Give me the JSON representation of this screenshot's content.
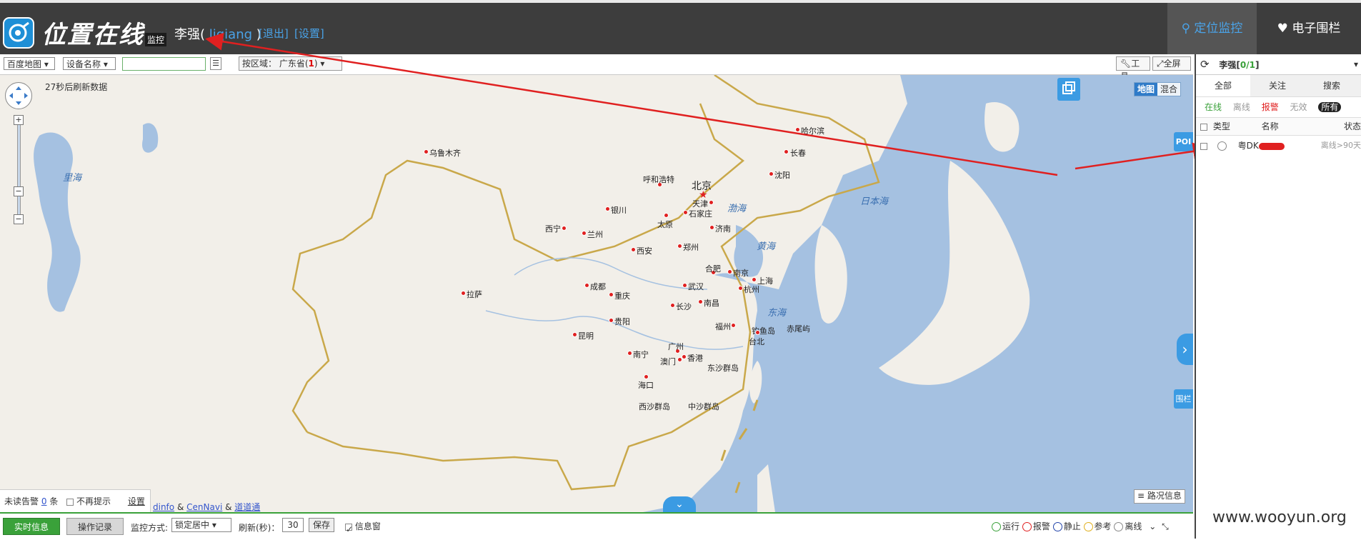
{
  "header": {
    "logo_text": "位置在线",
    "logo_badge": "监控",
    "user_name": "李强(",
    "user_account": " liqiang ",
    "user_close": ")",
    "logout": "[退出]",
    "settings": "[设置]",
    "nav_monitor": "定位监控",
    "nav_fence": "电子围栏"
  },
  "toolbar": {
    "map_select": "百度地图",
    "field_select": "设备名称",
    "search_value": "",
    "region_prefix": "按区域：",
    "region_name": "广东省(",
    "region_count": "1",
    "region_close": ")",
    "tools": "工具",
    "fullscreen": "全屏"
  },
  "map": {
    "refresh_text": "27秒后刷新数据",
    "maptype_map": "地图",
    "maptype_mixed": "混合",
    "poi": "POI",
    "fence": "围栏",
    "traffic": "路况信息",
    "attrib_a": "dinfo",
    "attrib_amp1": "&",
    "attrib_b": "CenNavi",
    "attrib_amp2": "&",
    "attrib_c": "道道通",
    "cities": {
      "urumqi": "乌鲁木齐",
      "harbin": "哈尔滨",
      "changchun": "长春",
      "shenyang": "沈阳",
      "hohhot": "呼和浩特",
      "beijing": "北京",
      "tianjin": "天津",
      "shijiazhuang": "石家庄",
      "taiyuan": "太原",
      "yinchuan": "银川",
      "jinan": "济南",
      "xining": "西宁",
      "lanzhou": "兰州",
      "xian": "西安",
      "zhengzhou": "郑州",
      "hefei": "合肥",
      "nanjing": "南京",
      "shanghai": "上海",
      "chengdu": "成都",
      "wuhan": "武汉",
      "hangzhou": "杭州",
      "lhasa": "拉萨",
      "chongqing": "重庆",
      "changsha": "长沙",
      "nanchang": "南昌",
      "guiyang": "贵阳",
      "fuzhou": "福州",
      "diaoyu": "钓鱼岛",
      "chiwei": "赤尾屿",
      "taibei": "台北",
      "kunming": "昆明",
      "guangzhou": "广州",
      "nanning": "南宁",
      "macau": "澳门",
      "hongkong": "香港",
      "dongsha": "东沙群岛",
      "haikou": "海口",
      "xisha": "西沙群岛",
      "zhongsha": "中沙群岛"
    },
    "seas": {
      "caspian": "里海",
      "bohai": "渤海",
      "yellow": "黄海",
      "east": "东海",
      "japan": "日本海"
    }
  },
  "alarm": {
    "unread_label": "未读告警",
    "unread_count": "0",
    "unread_unit": "条",
    "no_prompt": "不再提示",
    "settings": "设置"
  },
  "bottombar": {
    "realtime": "实时信息",
    "oplog": "操作记录",
    "monitor_mode_label": "监控方式:",
    "monitor_mode_value": "锁定居中",
    "refresh_label": "刷新(秒)：",
    "refresh_value": "30",
    "save": "保存",
    "info_window": "信息窗",
    "legend": [
      "运行",
      "报警",
      "静止",
      "参考",
      "离线"
    ]
  },
  "right_panel": {
    "title_name": "李强[",
    "title_count": "0/1",
    "title_close": "]",
    "tabs": [
      "全部",
      "关注",
      "搜索"
    ],
    "filters": [
      "在线",
      "离线",
      "报警",
      "无效",
      "所有"
    ],
    "columns": [
      "类型",
      "名称",
      "状态"
    ],
    "rows": [
      {
        "name": "粤DK",
        "status": "离线>90天"
      }
    ]
  },
  "watermark": "www.wooyun.org",
  "colors": {
    "topbar": "#3d3d3d",
    "accent_blue": "#3b9be3",
    "green": "#3aa13a",
    "sea": "#a5c1e1",
    "land": "#f2efe9",
    "annotation_red": "#e02020"
  }
}
